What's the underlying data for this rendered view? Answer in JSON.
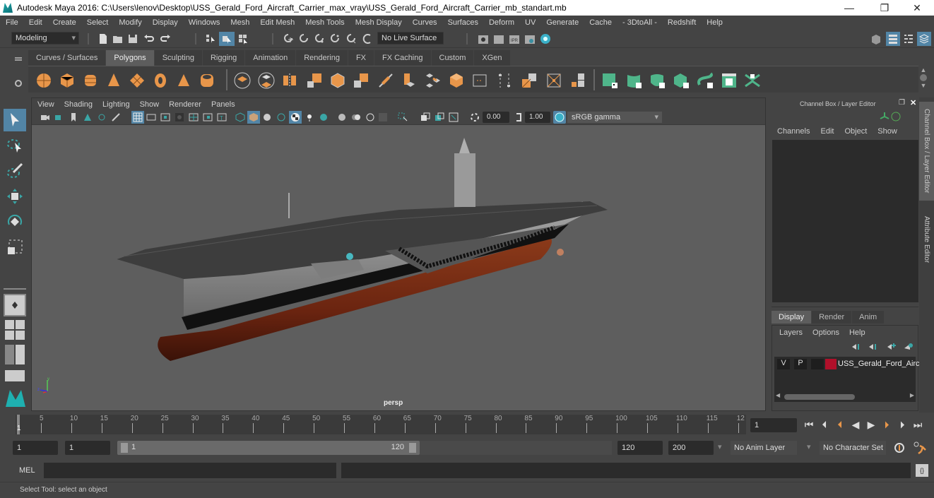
{
  "window": {
    "title": "Autodesk Maya 2016: C:\\Users\\lenov\\Desktop\\USS_Gerald_Ford_Aircraft_Carrier_max_vray\\USS_Gerald_Ford_Aircraft_Carrier_mb_standart.mb",
    "minimize": "—",
    "maximize": "❐",
    "close": "✕"
  },
  "menubar": [
    "File",
    "Edit",
    "Create",
    "Select",
    "Modify",
    "Display",
    "Windows",
    "Mesh",
    "Edit Mesh",
    "Mesh Tools",
    "Mesh Display",
    "Curves",
    "Surfaces",
    "Deform",
    "UV",
    "Generate",
    "Cache",
    "- 3DtoAll -",
    "Redshift",
    "Help"
  ],
  "statusline": {
    "mode": "Modeling",
    "live_surface": "No Live Surface"
  },
  "shelf": {
    "tabs": [
      "Curves / Surfaces",
      "Polygons",
      "Sculpting",
      "Rigging",
      "Animation",
      "Rendering",
      "FX",
      "FX Caching",
      "Custom",
      "XGen"
    ],
    "active_tab": "Polygons",
    "accent_orange": "#e8964a",
    "accent_green": "#4fb58a"
  },
  "viewport": {
    "menu": [
      "View",
      "Shading",
      "Lighting",
      "Show",
      "Renderer",
      "Panels"
    ],
    "exposure": "0.00",
    "gamma": "1.00",
    "color_space": "sRGB gamma",
    "camera_label": "persp",
    "axis": {
      "x": "x",
      "y": "y",
      "z": "z"
    }
  },
  "channel_box": {
    "title": "Channel Box / Layer Editor",
    "menu": [
      "Channels",
      "Edit",
      "Object",
      "Show"
    ],
    "side_tabs": [
      "Channel Box / Layer Editor",
      "Attribute Editor"
    ]
  },
  "layer_editor": {
    "tabs": [
      "Display",
      "Render",
      "Anim"
    ],
    "active_tab": "Display",
    "menu": [
      "Layers",
      "Options",
      "Help"
    ],
    "layers": [
      {
        "v": "V",
        "p": "P",
        "color": "#b0102a",
        "name": "USS_Gerald_Ford_Airci"
      }
    ]
  },
  "timeline": {
    "ticks": [
      "5",
      "10",
      "15",
      "20",
      "25",
      "30",
      "35",
      "40",
      "45",
      "50",
      "55",
      "60",
      "65",
      "70",
      "75",
      "80",
      "85",
      "90",
      "95",
      "100",
      "105",
      "110",
      "115",
      "12"
    ],
    "current_frame_marker": "1",
    "current_frame": "1"
  },
  "range": {
    "start": "1",
    "playback_start": "1",
    "slider_start": "1",
    "slider_end": "120",
    "playback_end": "120",
    "end": "200",
    "anim_layer": "No Anim Layer",
    "character_set": "No Character Set"
  },
  "command": {
    "label": "MEL"
  },
  "help_line": "Select Tool: select an object"
}
